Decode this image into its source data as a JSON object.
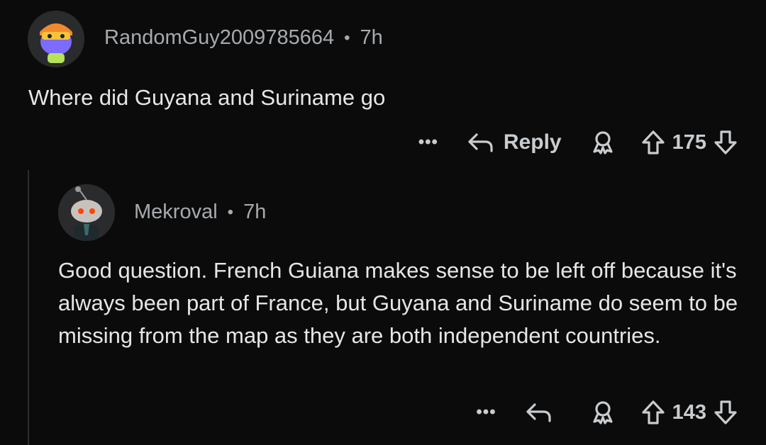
{
  "comment": {
    "author": "RandomGuy2009785664",
    "separator": "•",
    "age": "7h",
    "text": "Where did Guyana and Suriname go",
    "more_label": "•••",
    "reply_label": "Reply",
    "score": "175"
  },
  "reply": {
    "author": "Mekroval",
    "separator": "•",
    "age": "7h",
    "text": "Good question. French Guiana makes sense to be left off because it's always been part of France, but Guyana and Suriname do seem to be missing from the map as they are both independent countries.",
    "more_label": "•••",
    "score": "143"
  },
  "colors": {
    "background": "#0b0b0b",
    "text": "#e4e6e8",
    "meta": "#a7abaf",
    "thread_line": "#2b2d2f"
  },
  "icons": [
    "user-avatar",
    "reply-arrow-icon",
    "award-icon",
    "upvote-icon",
    "downvote-icon"
  ]
}
